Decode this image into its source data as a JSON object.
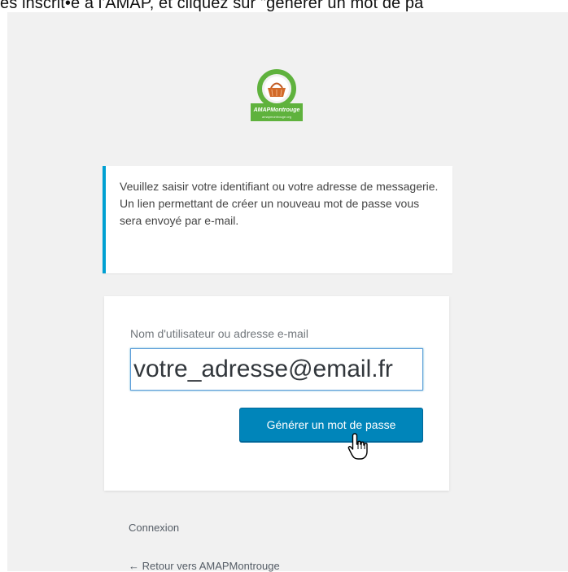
{
  "caption": "es inscrit•e à l'AMAP, et cliquez sur \"générer un mot de pa",
  "logo": {
    "text_line1": "AMAPMontrouge",
    "text_line2": "amapmontrouge.org"
  },
  "notice": {
    "text": "Veuillez saisir votre identifiant ou votre adresse de messagerie. Un lien permettant de créer un nouveau mot de passe vous sera envoyé par e-mail."
  },
  "form": {
    "user_label": "Nom d'utilisateur ou adresse e-mail",
    "user_value": "votre_adresse@email.fr",
    "submit_label": "Générer un mot de passe"
  },
  "nav": {
    "login_link": "Connexion",
    "back_link": "← Retour vers AMAPMontrouge"
  },
  "colors": {
    "accent": "#00a0d2",
    "button": "#0085ba",
    "logo_green": "#5fb23d"
  }
}
